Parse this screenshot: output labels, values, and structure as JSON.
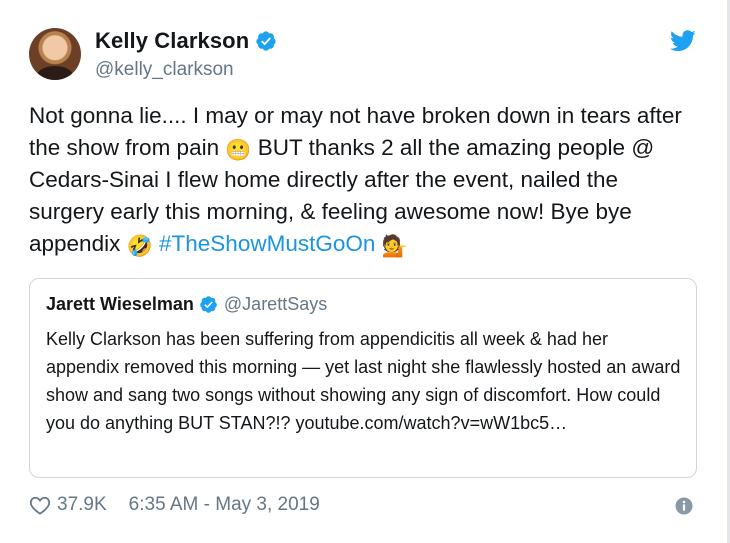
{
  "tweet": {
    "author": {
      "display_name": "Kelly Clarkson",
      "handle": "@kelly_clarkson"
    },
    "text": {
      "part1": "Not gonna lie.... I may or may not have broken down in tears after the show from pain ",
      "emoji1": "😬",
      "part2": " BUT thanks 2 all the amazing people @ Cedars-Sinai I flew home directly after the event, nailed the surgery early this morning, & feeling awesome now! Bye bye appendix ",
      "emoji2": "🤣",
      "hashtag": "#TheShowMustGoOn",
      "emoji3": "💁"
    },
    "quoted": {
      "display_name": "Jarett Wieselman",
      "handle": "@JarettSays",
      "text": "Kelly Clarkson has been suffering from appendicitis all week & had her appendix removed this morning — yet last night she flawlessly hosted an award show and sang two songs without showing any sign of discomfort. How could you do anything BUT STAN?!? youtube.com/watch?v=wW1bc5…"
    },
    "likes": "37.9K",
    "timestamp": "6:35 AM - May 3, 2019"
  },
  "colors": {
    "accent": "#1da1f2",
    "hashtag": "#1b95e0",
    "secondary_text": "#657786",
    "border": "#ccd6dd"
  },
  "icons": {
    "verified": "verified-badge-icon",
    "bird": "twitter-bird-icon",
    "heart": "heart-icon",
    "info": "info-icon"
  }
}
